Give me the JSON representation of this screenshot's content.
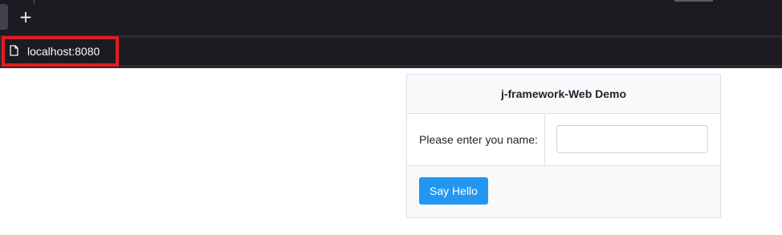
{
  "browser": {
    "new_tab_label": "+",
    "url": "localhost:8080",
    "highlight_color": "#e11d1d",
    "icons": {
      "page": "page-icon",
      "new_tab": "plus-icon"
    }
  },
  "page": {
    "header": "j-framework-Web Demo",
    "name_label": "Please enter you name:",
    "name_input": {
      "value": "",
      "placeholder": ""
    },
    "say_hello_label": "Say Hello",
    "colors": {
      "button": "#2196f3",
      "header_bg": "#f8f9fa"
    }
  }
}
